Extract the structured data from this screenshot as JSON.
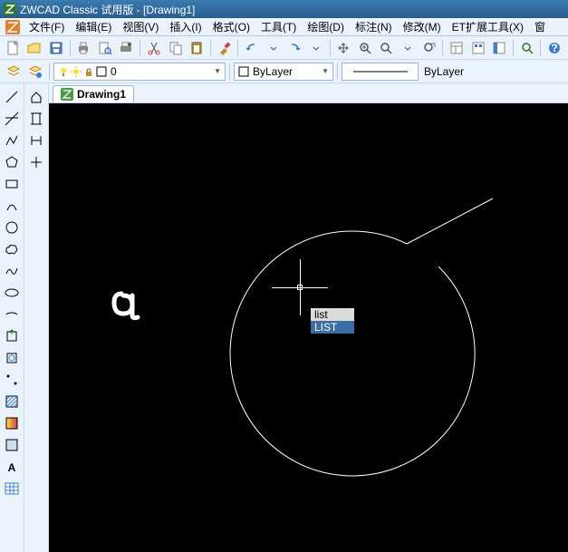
{
  "titlebar": {
    "app_name": "ZWCAD Classic 试用版",
    "doc_name": "[Drawing1]"
  },
  "menubar": {
    "items": [
      "文件(F)",
      "编辑(E)",
      "视图(V)",
      "插入(I)",
      "格式(O)",
      "工具(T)",
      "绘图(D)",
      "标注(N)",
      "修改(M)",
      "ET扩展工具(X)",
      "窗"
    ]
  },
  "toolbar2": {
    "layer_value": "0",
    "bylayer_value": "ByLayer",
    "linetype_label": "ByLayer"
  },
  "tab": {
    "label": "Drawing1"
  },
  "command": {
    "typed": "list",
    "suggestion": "LIST"
  }
}
